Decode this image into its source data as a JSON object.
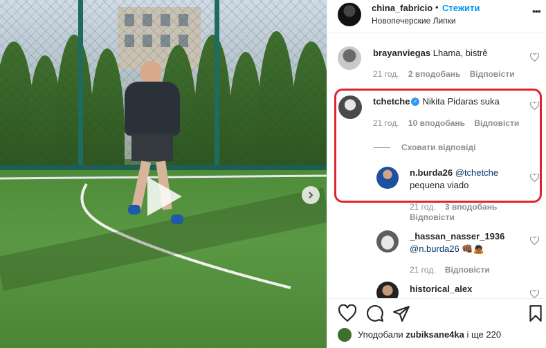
{
  "post": {
    "username": "china_fabricio",
    "separator": "•",
    "follow_label": "Стежити",
    "location": "Новопечерские Липки"
  },
  "comments": [
    {
      "username": "brayanviegas",
      "text": "Lhama, bistrê",
      "time": "21 год.",
      "likes": "2 вподобань",
      "reply": "Відповісти"
    },
    {
      "username": "tchetche",
      "text": "Nikita Pidaras suka",
      "time": "21 год.",
      "likes": "10 вподобань",
      "reply": "Відповісти",
      "hide_replies": "Сховати відповіді",
      "replies": [
        {
          "username": "n.burda26",
          "mention": "@tchetche",
          "text": "pequena viado",
          "time": "21 год.",
          "likes": "3 вподобань",
          "reply": "Відповісти"
        },
        {
          "username": "_hassan_nasser_1936",
          "mention": "@n.burda26",
          "text": "👊🏾🙇🏾",
          "time": "21 год.",
          "reply": "Відповісти"
        },
        {
          "username": "historical_alex"
        }
      ]
    }
  ],
  "footer": {
    "liked_by_prefix": "Уподобали",
    "liked_by_user": "zubiksane4ka",
    "liked_by_suffix": "і ще 220"
  },
  "colors": {
    "accent": "#0095f6",
    "highlight": "#e0242b",
    "verified": "#3897f0"
  },
  "icons": [
    "play-icon",
    "chevron-right-icon",
    "more-icon",
    "heart-icon",
    "verified-icon",
    "comment-icon",
    "share-icon",
    "bookmark-icon"
  ]
}
